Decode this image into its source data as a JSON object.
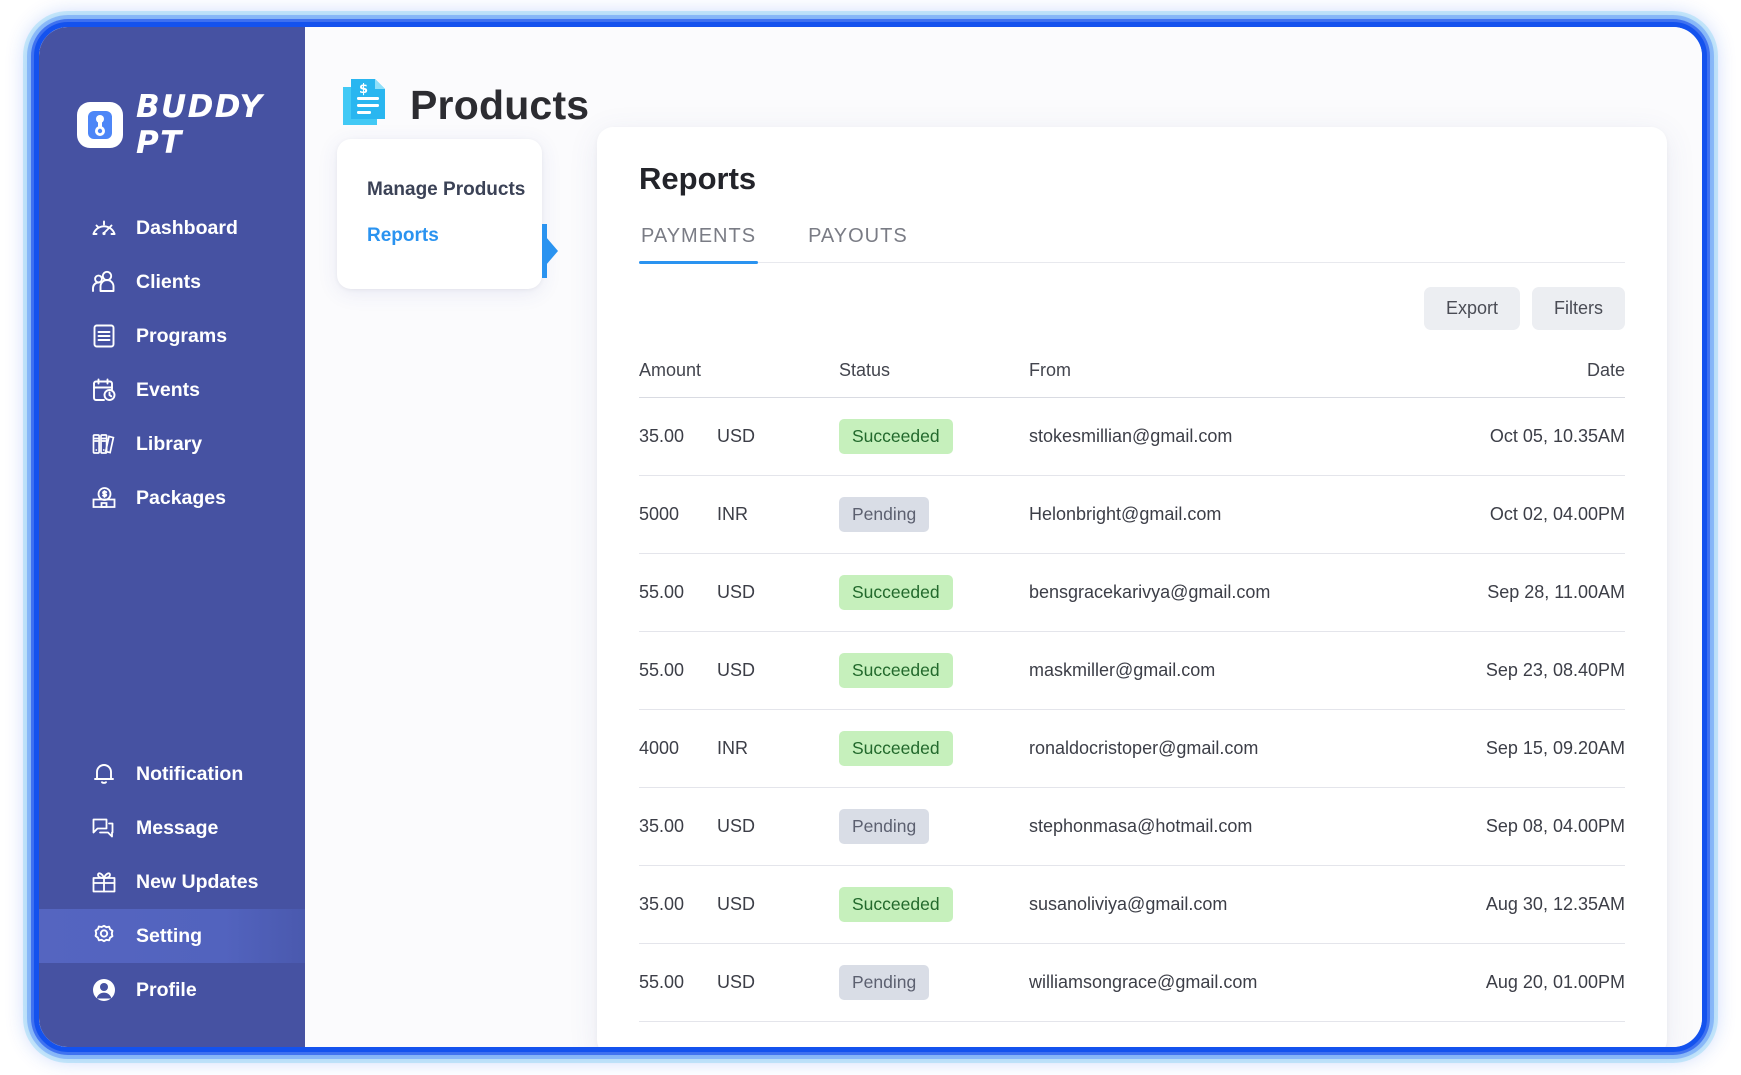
{
  "brand": {
    "name": "BUDDY PT",
    "logo_letter": "B"
  },
  "sidebar": {
    "items_top": [
      {
        "label": "Dashboard",
        "icon": "gauge-icon",
        "active": false
      },
      {
        "label": "Clients",
        "icon": "people-icon",
        "active": false
      },
      {
        "label": "Programs",
        "icon": "document-icon",
        "active": false
      },
      {
        "label": "Events",
        "icon": "calendar-clock-icon",
        "active": false
      },
      {
        "label": "Library",
        "icon": "books-icon",
        "active": false
      },
      {
        "label": "Packages",
        "icon": "money-box-icon",
        "active": false
      }
    ],
    "items_bottom": [
      {
        "label": "Notification",
        "icon": "bell-icon",
        "active": false
      },
      {
        "label": "Message",
        "icon": "chat-icon",
        "active": false
      },
      {
        "label": "New Updates",
        "icon": "gift-icon",
        "active": false
      },
      {
        "label": "Setting",
        "icon": "gear-icon",
        "active": true
      },
      {
        "label": "Profile",
        "icon": "avatar-icon",
        "active": false
      }
    ]
  },
  "header": {
    "title": "Products",
    "icon": "invoice-document-icon"
  },
  "subnav": {
    "items": [
      {
        "label": "Manage Products",
        "active": false
      },
      {
        "label": "Reports",
        "active": true
      }
    ]
  },
  "reports": {
    "title": "Reports",
    "tabs": [
      {
        "label": "PAYMENTS",
        "active": true
      },
      {
        "label": "PAYOUTS",
        "active": false
      }
    ],
    "buttons": {
      "export": "Export",
      "filters": "Filters"
    },
    "columns": [
      "Amount",
      "Status",
      "From",
      "Date"
    ],
    "rows": [
      {
        "amount": "35.00",
        "currency": "USD",
        "status": "Succeeded",
        "from": "stokesmillian@gmail.com",
        "date": "Oct 05, 10.35AM"
      },
      {
        "amount": "5000",
        "currency": "INR",
        "status": "Pending",
        "from": "Helonbright@gmail.com",
        "date": "Oct 02, 04.00PM"
      },
      {
        "amount": "55.00",
        "currency": "USD",
        "status": "Succeeded",
        "from": "bensgracekarivya@gmail.com",
        "date": "Sep 28, 11.00AM"
      },
      {
        "amount": "55.00",
        "currency": "USD",
        "status": "Succeeded",
        "from": "maskmiller@gmail.com",
        "date": "Sep 23, 08.40PM"
      },
      {
        "amount": "4000",
        "currency": "INR",
        "status": "Succeeded",
        "from": "ronaldocristoper@gmail.com",
        "date": "Sep 15,  09.20AM"
      },
      {
        "amount": "35.00",
        "currency": "USD",
        "status": "Pending",
        "from": "stephonmasa@hotmail.com",
        "date": "Sep 08, 04.00PM"
      },
      {
        "amount": "35.00",
        "currency": "USD",
        "status": "Succeeded",
        "from": "susanoliviya@gmail.com",
        "date": "Aug 30, 12.35AM"
      },
      {
        "amount": "55.00",
        "currency": "USD",
        "status": "Pending",
        "from": "williamsongrace@gmail.com",
        "date": "Aug 20, 01.00PM"
      }
    ]
  },
  "colors": {
    "sidebar_bg": "#4652A2",
    "accent_blue": "#2A93F0",
    "frame_blue": "#1452EE",
    "success_bg": "#C6F0BC",
    "success_text": "#22692C",
    "pending_bg": "#D9DDE6",
    "pending_text": "#5C6070"
  }
}
